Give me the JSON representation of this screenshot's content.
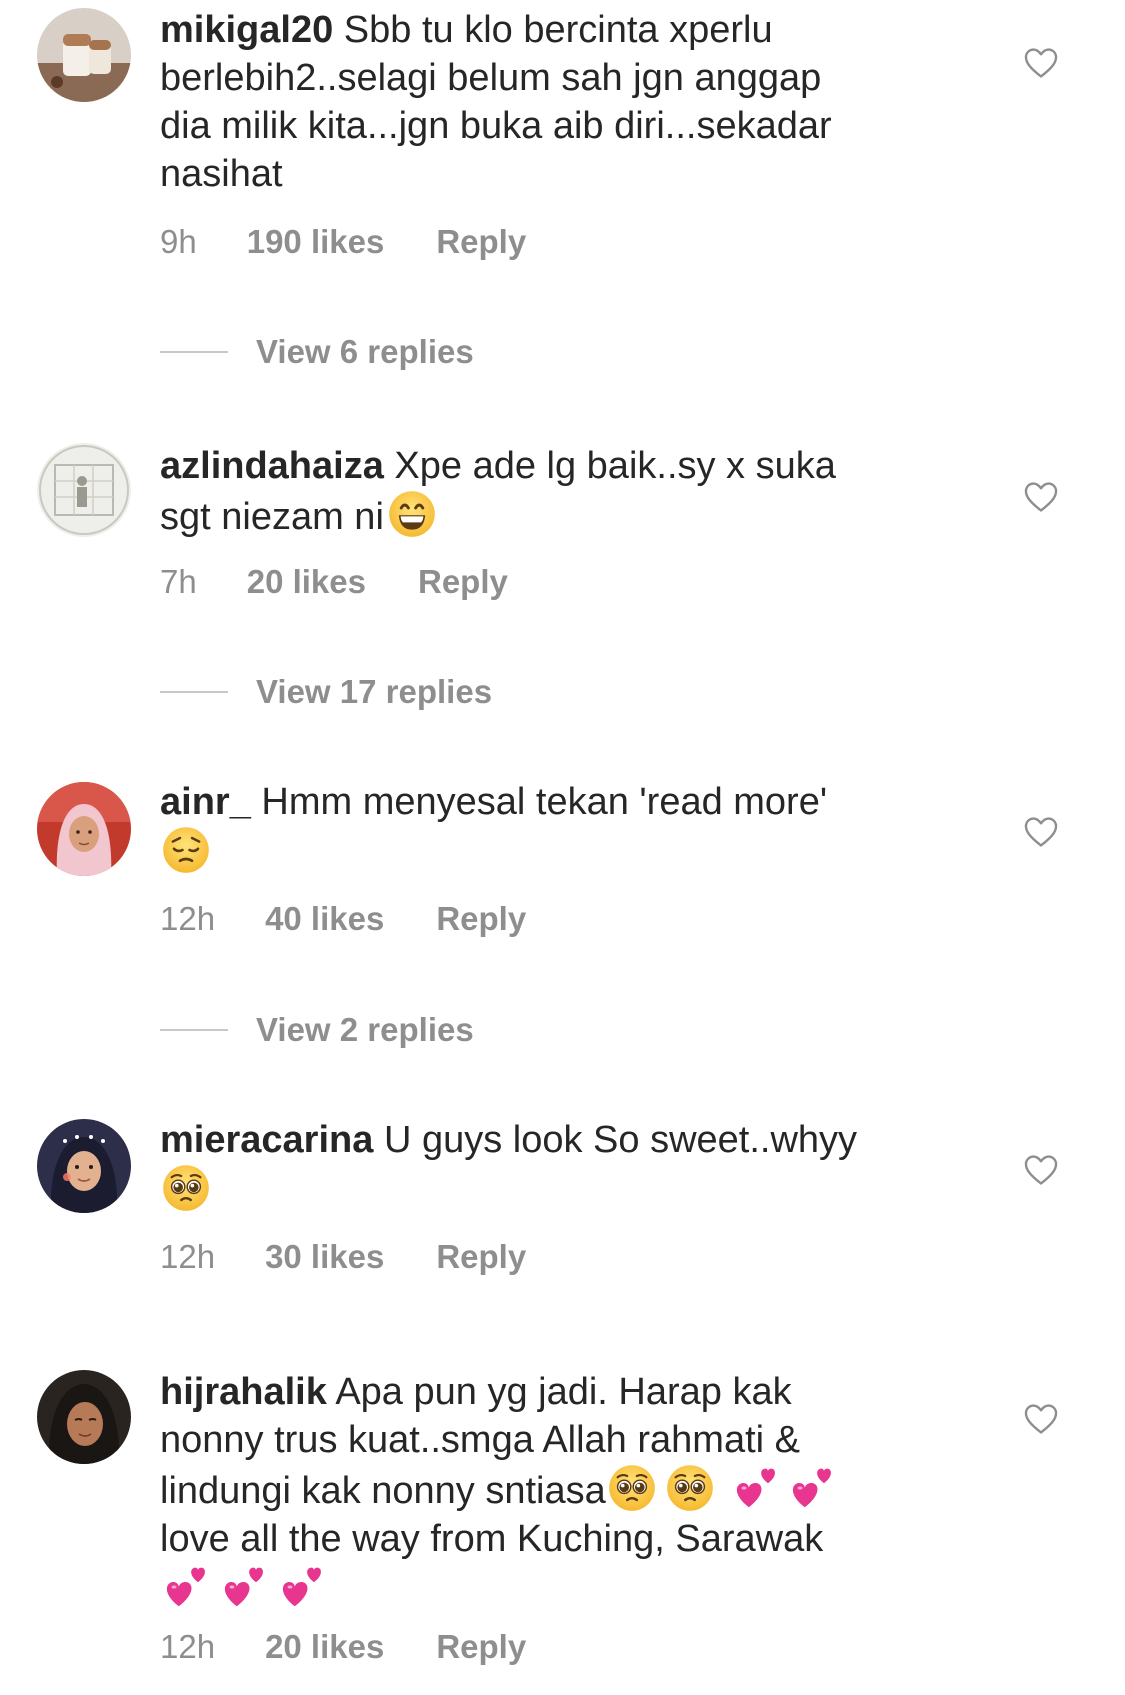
{
  "comments": [
    {
      "username": "mikigal20",
      "text_lines": [
        "Sbb tu klo bercinta xperlu",
        "berlebih2..selagi belum sah jgn  anggap",
        "dia milik kita...jgn buka aib diri...sekadar",
        "nasihat"
      ],
      "time": "9h",
      "likes": "190 likes",
      "reply": "Reply",
      "view_replies": "View 6 replies"
    },
    {
      "username": "azlindahaiza",
      "text_lines": [
        "Xpe ade lg baik..sy x suka",
        "sgt niezam ni"
      ],
      "time": "7h",
      "likes": "20 likes",
      "reply": "Reply",
      "view_replies": "View 17 replies"
    },
    {
      "username": "ainr_",
      "text_lines": [
        "Hmm menyesal tekan 'read more'"
      ],
      "time": "12h",
      "likes": "40 likes",
      "reply": "Reply",
      "view_replies": "View 2 replies"
    },
    {
      "username": "mieracarina",
      "text_lines": [
        "U guys look So sweet..whyy"
      ],
      "time": "12h",
      "likes": "30 likes",
      "reply": "Reply"
    },
    {
      "username": "hijrahalik",
      "text_lines": [
        "Apa pun yg jadi. Harap kak",
        "nonny trus kuat..smga Allah rahmati &",
        "lindungi kak nonny sntiasa",
        "love all the way from Kuching, Sarawak"
      ],
      "time": "12h",
      "likes": "20 likes",
      "reply": "Reply"
    }
  ],
  "emojis": {
    "c1": "grinning-face",
    "c2": "pensive-face",
    "c3": "pleading-face",
    "c4": [
      "pleading-face",
      "pleading-face",
      "two-hearts",
      "two-hearts",
      "two-hearts",
      "two-hearts",
      "two-hearts"
    ]
  },
  "icons": {
    "like": "heart-outline-icon"
  },
  "colors": {
    "text": "#262626",
    "secondary": "#8e8e8e",
    "divider": "#c7c7c7",
    "heart_emoji": "#e8358f"
  }
}
